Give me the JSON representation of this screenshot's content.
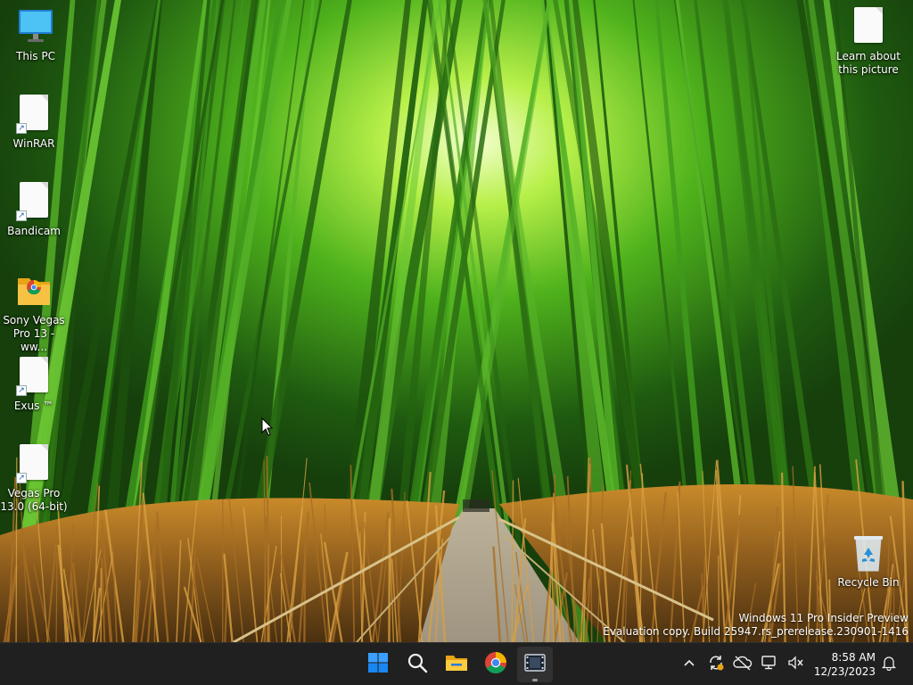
{
  "desktop": {
    "icons_left": [
      {
        "name": "this-pc",
        "label": "This PC"
      },
      {
        "name": "winrar",
        "label": "WinRAR"
      },
      {
        "name": "bandicam",
        "label": "Bandicam"
      },
      {
        "name": "sony-vegas",
        "label": "Sony Vegas Pro 13 - ww..."
      },
      {
        "name": "exus",
        "label": "Exus ™"
      },
      {
        "name": "vegas-pro",
        "label": "Vegas Pro 13.0 (64-bit)"
      }
    ],
    "icon_learn": {
      "label": "Learn about this picture"
    },
    "icon_recycle": {
      "label": "Recycle Bin"
    }
  },
  "watermark": {
    "line1": "Windows 11 Pro Insider Preview",
    "line2": "Evaluation copy. Build 25947.rs_prerelease.230901-1416"
  },
  "taskbar": {
    "apps": [
      {
        "name": "start",
        "icon": "windows-logo-icon"
      },
      {
        "name": "search",
        "icon": "search-icon"
      },
      {
        "name": "file-explorer",
        "icon": "folder-icon"
      },
      {
        "name": "chrome",
        "icon": "chrome-icon"
      },
      {
        "name": "video-app",
        "icon": "film-icon",
        "active": true
      }
    ],
    "clock": {
      "time": "8:58 AM",
      "date": "12/23/2023"
    }
  },
  "colors": {
    "taskbar_bg": "#202020",
    "accent": "#0078d4"
  }
}
